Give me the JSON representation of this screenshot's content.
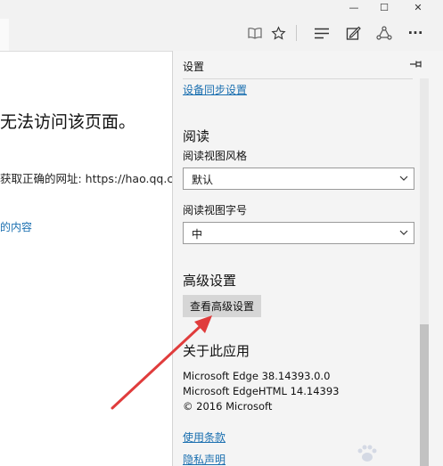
{
  "titlebar": {
    "minimize": "—",
    "maximize": "☐",
    "close": "✕"
  },
  "toolbar": {
    "icons": [
      "reading-view-icon",
      "favorite-star-icon",
      "hub-icon",
      "web-note-icon",
      "share-icon",
      "more-icon"
    ],
    "more_glyph": "···"
  },
  "page": {
    "heading": "无法访问该页面。",
    "message": "获取正确的网址: https://hao.qq.c",
    "link": "的内容"
  },
  "settings": {
    "title": "设置",
    "sync_link": "设备同步设置",
    "reading": {
      "title": "阅读",
      "style_label": "阅读视图风格",
      "style_value": "默认",
      "font_label": "阅读视图字号",
      "font_value": "中"
    },
    "advanced": {
      "title": "高级设置",
      "button": "查看高级设置"
    },
    "about": {
      "title": "关于此应用",
      "lines": [
        "Microsoft Edge 38.14393.0.0",
        "Microsoft EdgeHTML 14.14393",
        "© 2016 Microsoft"
      ],
      "terms_link": "使用条款",
      "privacy_link": "隐私声明"
    }
  },
  "colors": {
    "link": "#1a6fb0",
    "annotation_arrow": "#e03c3c",
    "panel_bg": "#f4f4f4",
    "button_bg": "#d6d6d6"
  }
}
